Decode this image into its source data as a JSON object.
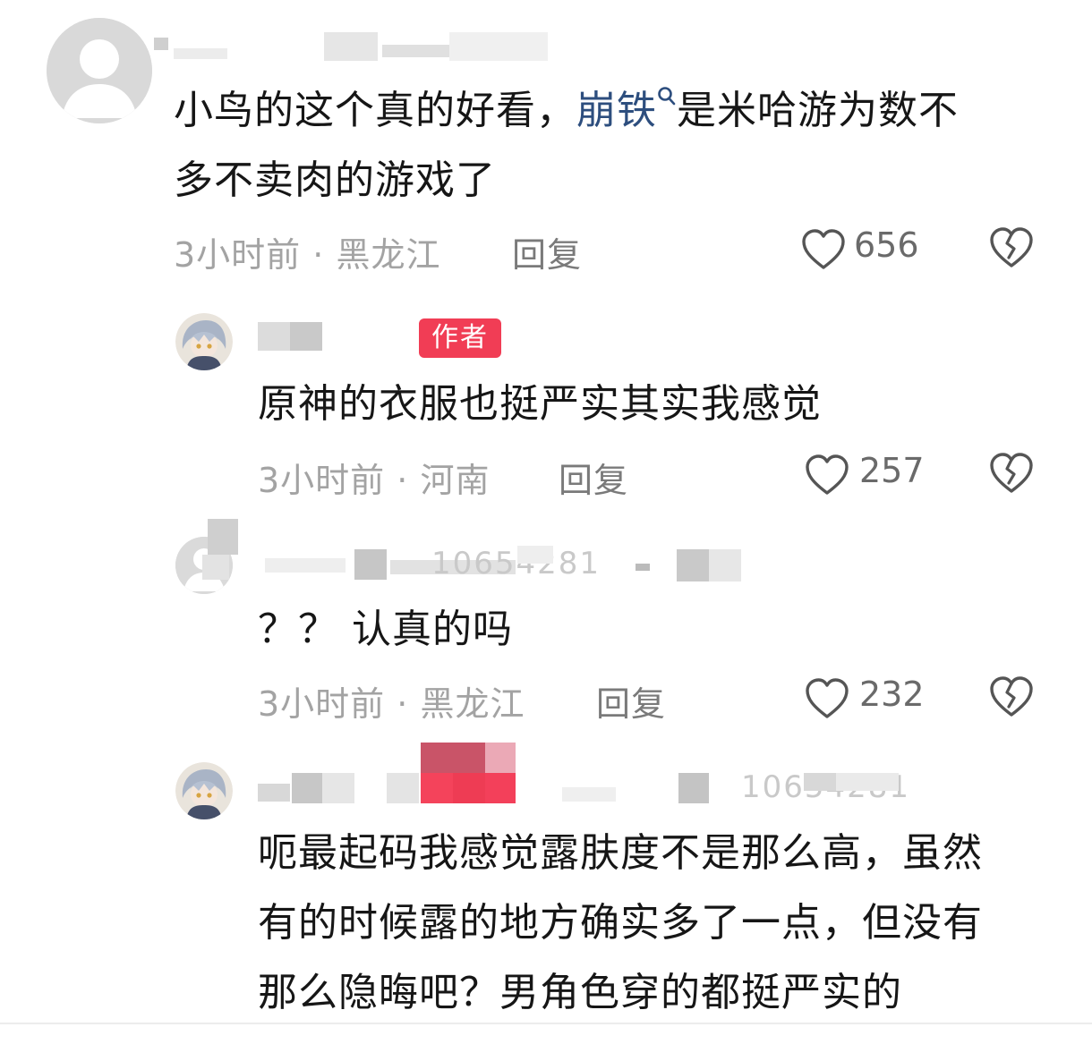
{
  "comments": [
    {
      "text_line1_a": "小鸟的这个真的好看，",
      "link": "崩铁",
      "text_line1_b": "是米哈游为数不",
      "text_line2": "多不卖肉的游戏了",
      "time": "3小时前",
      "location": "黑龙江",
      "reply_label": "回复",
      "likes": "656",
      "icons": {
        "avatar": "default-avatar-icon",
        "search": "search-icon",
        "like": "heart-outline-icon",
        "dislike": "broken-heart-icon"
      }
    },
    {
      "badge": "作者",
      "text_line1": "原神的衣服也挺严实其实我感觉",
      "time": "3小时前",
      "location": "河南",
      "reply_label": "回复",
      "likes": "257",
      "icons": {
        "avatar": "anime-avatar-icon",
        "like": "heart-outline-icon",
        "dislike": "broken-heart-icon"
      }
    },
    {
      "username_partial": "10654281",
      "text_line1": "？？ 认真的吗",
      "time": "3小时前",
      "location": "黑龙江",
      "reply_label": "回复",
      "likes": "232",
      "icons": {
        "avatar": "default-avatar-icon",
        "like": "heart-outline-icon",
        "dislike": "broken-heart-icon"
      }
    },
    {
      "username_partial": "10654281",
      "text_line1": "呃最起码我感觉露肤度不是那么高，虽然",
      "text_line2": "有的时候露的地方确实多了一点，但没有",
      "text_line3": "那么隐晦吧？男角色穿的都挺严实的",
      "icons": {
        "avatar": "anime-avatar-icon"
      }
    }
  ],
  "colors": {
    "badge": "#f13d55",
    "link": "#2d4e7e",
    "meta": "#a3a3a3"
  }
}
